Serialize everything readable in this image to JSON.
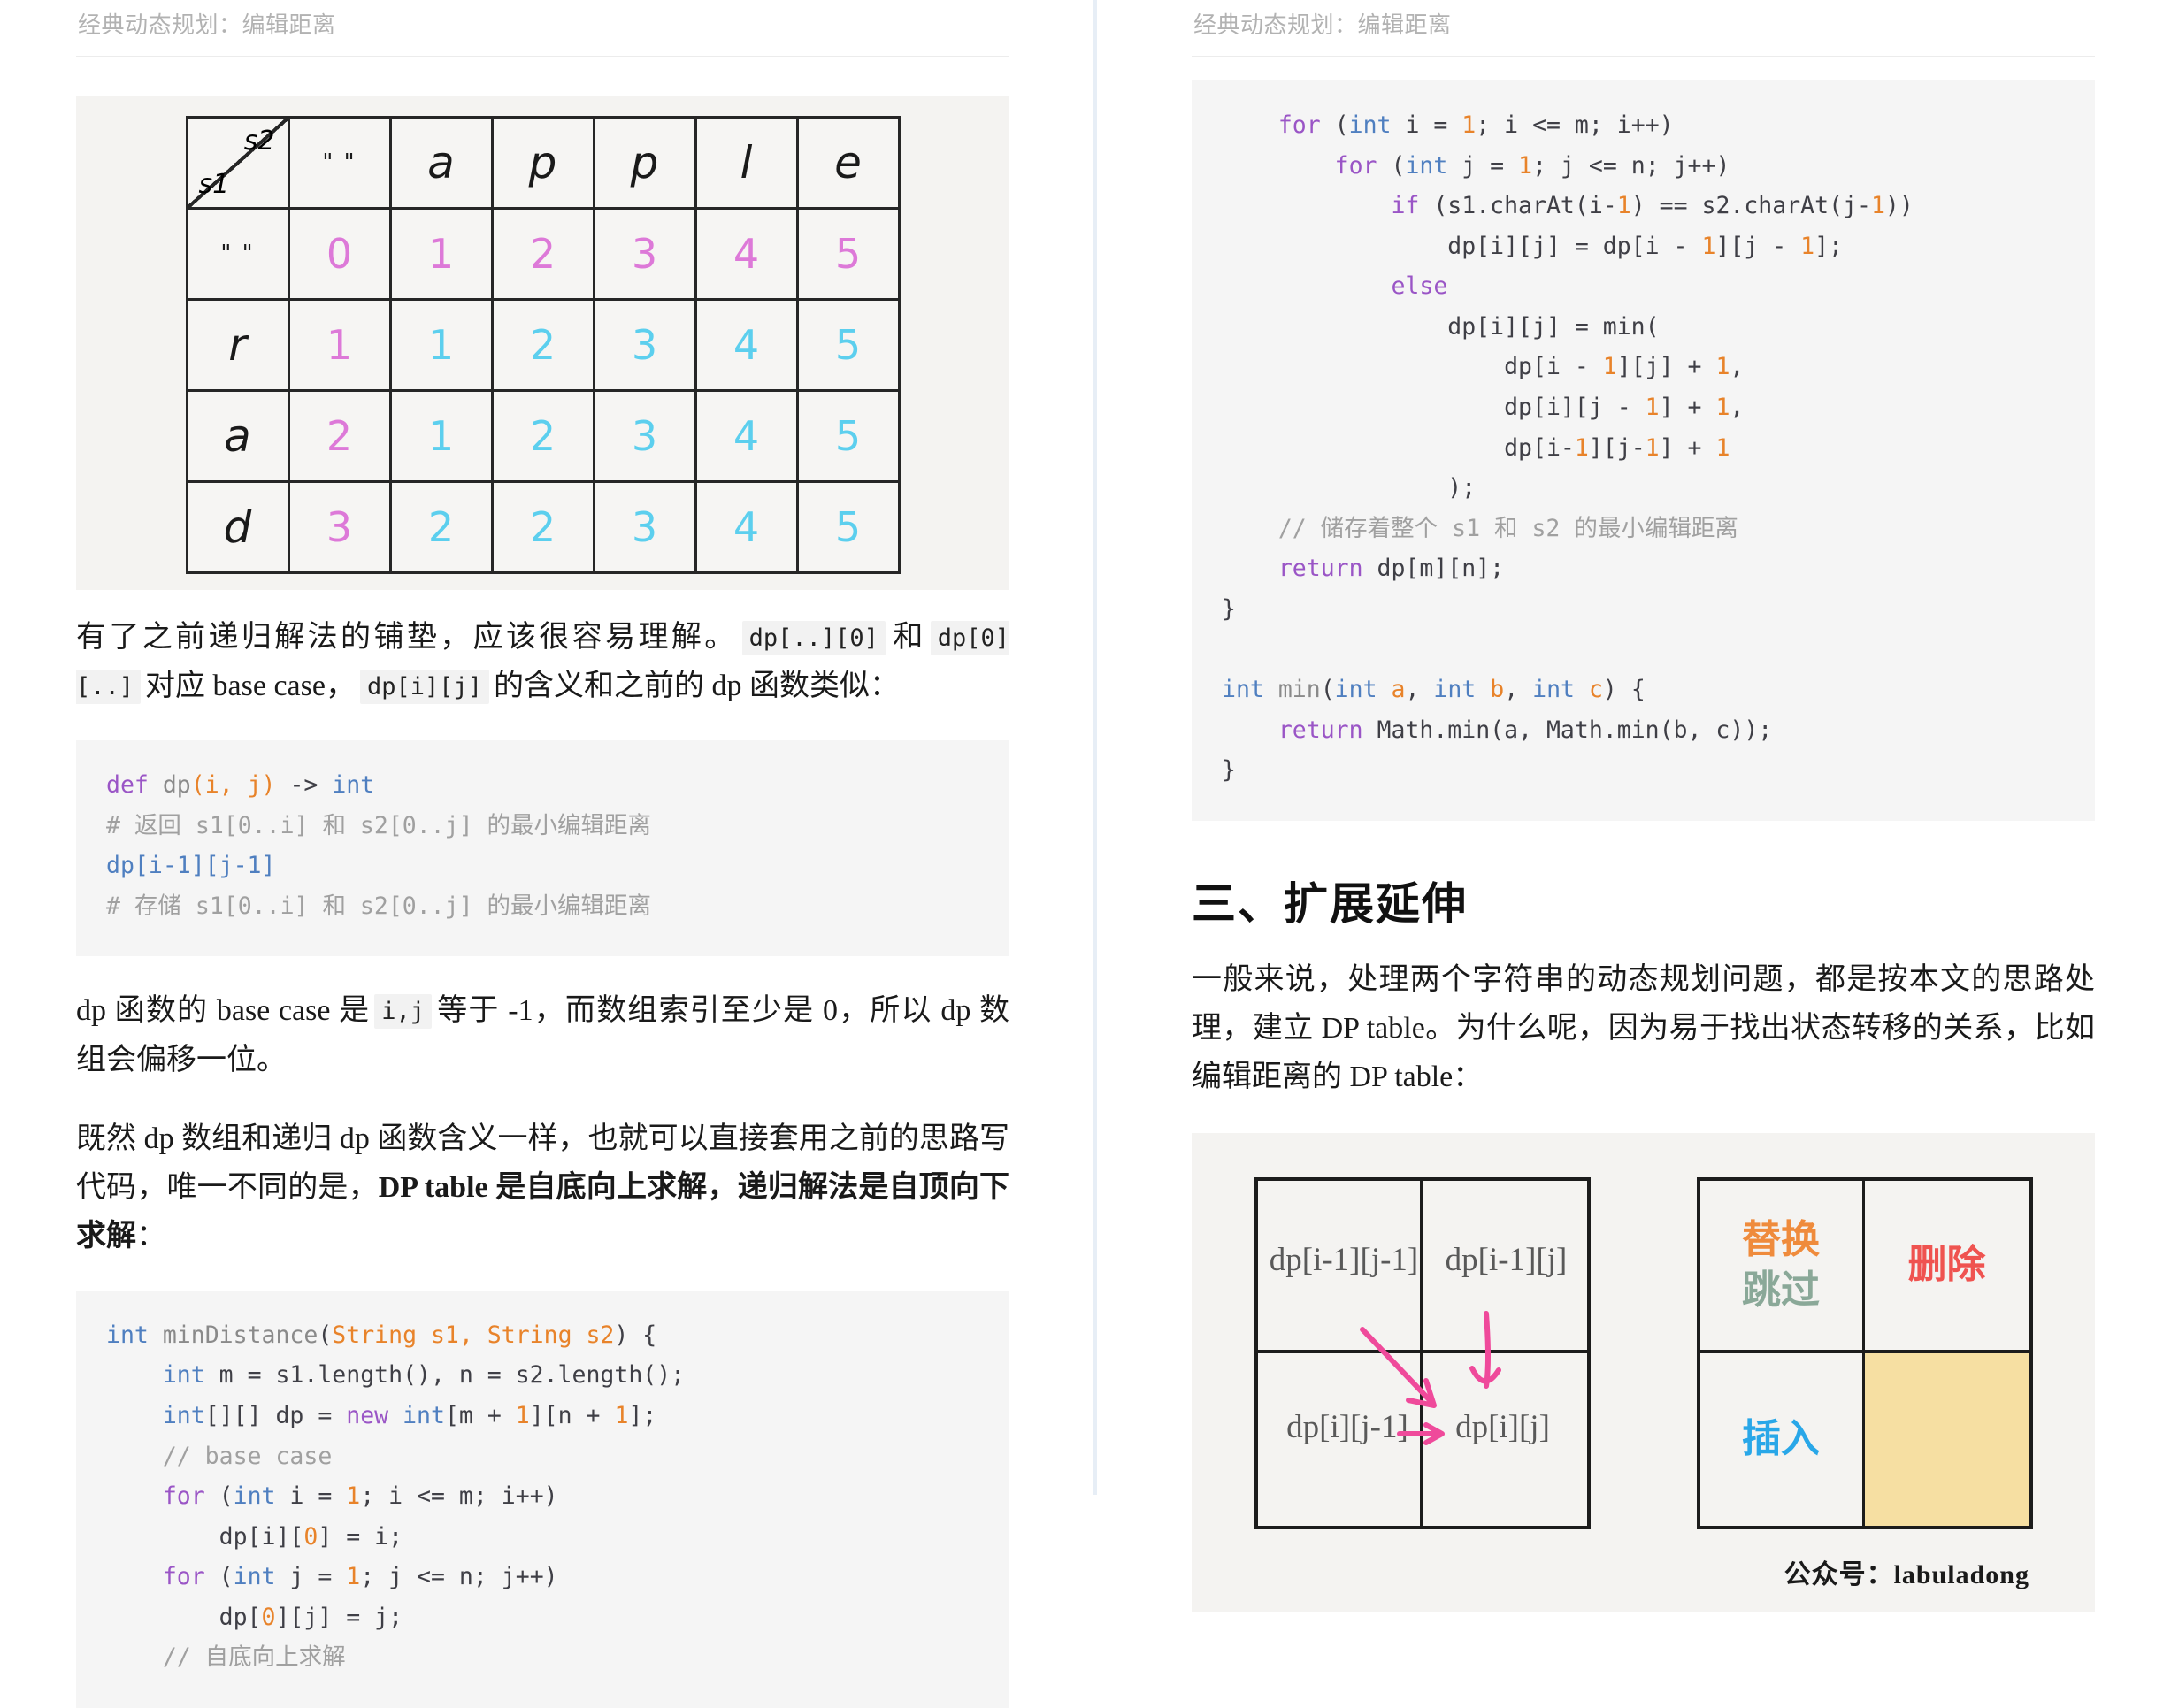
{
  "header": {
    "title": "经典动态规划：编辑距离"
  },
  "figure_dp_table": {
    "corner": {
      "s2": "s2",
      "s1": "s1"
    },
    "col_headers": [
      "\" \"",
      "a",
      "p",
      "p",
      "l",
      "e"
    ],
    "row_headers": [
      "\" \"",
      "r",
      "a",
      "d"
    ],
    "rows": [
      [
        "0",
        "1",
        "2",
        "3",
        "4",
        "5"
      ],
      [
        "1",
        "1",
        "2",
        "3",
        "4",
        "5"
      ],
      [
        "2",
        "1",
        "2",
        "3",
        "4",
        "5"
      ],
      [
        "3",
        "2",
        "2",
        "3",
        "4",
        "5"
      ]
    ],
    "colors": {
      "base": "#dd79d8",
      "computed": "#5ccfee"
    }
  },
  "left": {
    "para1": {
      "t1": "有了之前递归解法的铺垫，应该很容易理解。",
      "c1": "dp[..][0]",
      "t2": "和",
      "c2": "dp[0][..]",
      "t3": "对应 base case，",
      "c3": "dp[i][j]",
      "t4": "的含义和之前的 dp 函数类似："
    },
    "code1": [
      {
        "parts": [
          {
            "c": "k",
            "t": "def "
          },
          {
            "c": "fn",
            "t": "dp"
          },
          {
            "c": "pa",
            "t": "(i, j)"
          },
          {
            "c": "pl",
            "t": " -> "
          },
          {
            "c": "ty",
            "t": "int"
          }
        ]
      },
      {
        "parts": [
          {
            "c": "cm",
            "t": "# 返回 s1[0..i] 和 s2[0..j] 的最小编辑距离"
          }
        ]
      },
      {
        "parts": [
          {
            "c": "ty",
            "t": "dp[i-1][j-1]"
          }
        ]
      },
      {
        "parts": [
          {
            "c": "cm",
            "t": "# 存储 s1[0..i] 和 s2[0..j] 的最小编辑距离"
          }
        ]
      }
    ],
    "para2": {
      "t1": "dp 函数的 base case 是",
      "c1": "i,j",
      "t2": "等于 -1，而数组索引至少是 0，所以 dp 数组会偏移一位。"
    },
    "para3": {
      "t1": "既然 dp 数组和递归 dp 函数含义一样，也就可以直接套用之前的思路写代码，唯一不同的是，",
      "strong": "DP table 是自底向上求解，递归解法是自顶向下求解",
      "t2": "："
    },
    "code2": [
      {
        "parts": [
          {
            "c": "ty",
            "t": "int "
          },
          {
            "c": "fn",
            "t": "minDistance"
          },
          {
            "c": "pl",
            "t": "("
          },
          {
            "c": "pa",
            "t": "String s1, String s2"
          },
          {
            "c": "pl",
            "t": ") {"
          }
        ]
      },
      {
        "parts": [
          {
            "c": "pl",
            "t": "    "
          },
          {
            "c": "ty",
            "t": "int"
          },
          {
            "c": "pl",
            "t": " m = s1.length(), n = s2.length();"
          }
        ]
      },
      {
        "parts": [
          {
            "c": "pl",
            "t": "    "
          },
          {
            "c": "ty",
            "t": "int"
          },
          {
            "c": "pl",
            "t": "[][] dp = "
          },
          {
            "c": "k",
            "t": "new "
          },
          {
            "c": "ty",
            "t": "int"
          },
          {
            "c": "pl",
            "t": "[m + "
          },
          {
            "c": "pa",
            "t": "1"
          },
          {
            "c": "pl",
            "t": "][n + "
          },
          {
            "c": "pa",
            "t": "1"
          },
          {
            "c": "pl",
            "t": "];"
          }
        ]
      },
      {
        "parts": [
          {
            "c": "cm",
            "t": "    // base case"
          }
        ]
      },
      {
        "parts": [
          {
            "c": "pl",
            "t": "    "
          },
          {
            "c": "k",
            "t": "for"
          },
          {
            "c": "pl",
            "t": " ("
          },
          {
            "c": "ty",
            "t": "int"
          },
          {
            "c": "pl",
            "t": " i = "
          },
          {
            "c": "pa",
            "t": "1"
          },
          {
            "c": "pl",
            "t": "; i <= m; i++)"
          }
        ]
      },
      {
        "parts": [
          {
            "c": "pl",
            "t": "        dp[i]["
          },
          {
            "c": "pa",
            "t": "0"
          },
          {
            "c": "pl",
            "t": "] = i;"
          }
        ]
      },
      {
        "parts": [
          {
            "c": "pl",
            "t": "    "
          },
          {
            "c": "k",
            "t": "for"
          },
          {
            "c": "pl",
            "t": " ("
          },
          {
            "c": "ty",
            "t": "int"
          },
          {
            "c": "pl",
            "t": " j = "
          },
          {
            "c": "pa",
            "t": "1"
          },
          {
            "c": "pl",
            "t": "; j <= n; j++)"
          }
        ]
      },
      {
        "parts": [
          {
            "c": "pl",
            "t": "        dp["
          },
          {
            "c": "pa",
            "t": "0"
          },
          {
            "c": "pl",
            "t": "][j] = j;"
          }
        ]
      },
      {
        "parts": [
          {
            "c": "cm",
            "t": "    // 自底向上求解"
          }
        ]
      }
    ]
  },
  "right": {
    "code3": [
      {
        "parts": [
          {
            "c": "pl",
            "t": "    "
          },
          {
            "c": "k",
            "t": "for"
          },
          {
            "c": "pl",
            "t": " ("
          },
          {
            "c": "ty",
            "t": "int"
          },
          {
            "c": "pl",
            "t": " i = "
          },
          {
            "c": "pa",
            "t": "1"
          },
          {
            "c": "pl",
            "t": "; i <= m; i++)"
          }
        ]
      },
      {
        "parts": [
          {
            "c": "pl",
            "t": "        "
          },
          {
            "c": "k",
            "t": "for"
          },
          {
            "c": "pl",
            "t": " ("
          },
          {
            "c": "ty",
            "t": "int"
          },
          {
            "c": "pl",
            "t": " j = "
          },
          {
            "c": "pa",
            "t": "1"
          },
          {
            "c": "pl",
            "t": "; j <= n; j++)"
          }
        ]
      },
      {
        "parts": [
          {
            "c": "pl",
            "t": "            "
          },
          {
            "c": "k",
            "t": "if"
          },
          {
            "c": "pl",
            "t": " (s1.charAt(i-"
          },
          {
            "c": "pa",
            "t": "1"
          },
          {
            "c": "pl",
            "t": ") == s2.charAt(j-"
          },
          {
            "c": "pa",
            "t": "1"
          },
          {
            "c": "pl",
            "t": "))"
          }
        ]
      },
      {
        "parts": [
          {
            "c": "pl",
            "t": "                dp[i][j] = dp[i - "
          },
          {
            "c": "pa",
            "t": "1"
          },
          {
            "c": "pl",
            "t": "][j - "
          },
          {
            "c": "pa",
            "t": "1"
          },
          {
            "c": "pl",
            "t": "];"
          }
        ]
      },
      {
        "parts": [
          {
            "c": "pl",
            "t": "            "
          },
          {
            "c": "k",
            "t": "else"
          }
        ]
      },
      {
        "parts": [
          {
            "c": "pl",
            "t": "                dp[i][j] = min("
          }
        ]
      },
      {
        "parts": [
          {
            "c": "pl",
            "t": "                    dp[i - "
          },
          {
            "c": "pa",
            "t": "1"
          },
          {
            "c": "pl",
            "t": "][j] + "
          },
          {
            "c": "pa",
            "t": "1"
          },
          {
            "c": "pl",
            "t": ","
          }
        ]
      },
      {
        "parts": [
          {
            "c": "pl",
            "t": "                    dp[i][j - "
          },
          {
            "c": "pa",
            "t": "1"
          },
          {
            "c": "pl",
            "t": "] + "
          },
          {
            "c": "pa",
            "t": "1"
          },
          {
            "c": "pl",
            "t": ","
          }
        ]
      },
      {
        "parts": [
          {
            "c": "pl",
            "t": "                    dp[i-"
          },
          {
            "c": "pa",
            "t": "1"
          },
          {
            "c": "pl",
            "t": "][j-"
          },
          {
            "c": "pa",
            "t": "1"
          },
          {
            "c": "pl",
            "t": "] + "
          },
          {
            "c": "pa",
            "t": "1"
          }
        ]
      },
      {
        "parts": [
          {
            "c": "pl",
            "t": "                );"
          }
        ]
      },
      {
        "parts": [
          {
            "c": "cm",
            "t": "    // 储存着整个 s1 和 s2 的最小编辑距离"
          }
        ]
      },
      {
        "parts": [
          {
            "c": "pl",
            "t": "    "
          },
          {
            "c": "k",
            "t": "return"
          },
          {
            "c": "pl",
            "t": " dp[m][n];"
          }
        ]
      },
      {
        "parts": [
          {
            "c": "pl",
            "t": "}"
          }
        ]
      },
      {
        "parts": [
          {
            "c": "pl",
            "t": ""
          }
        ]
      },
      {
        "parts": [
          {
            "c": "ty",
            "t": "int "
          },
          {
            "c": "fn",
            "t": "min"
          },
          {
            "c": "pl",
            "t": "("
          },
          {
            "c": "ty",
            "t": "int"
          },
          {
            "c": "pa",
            "t": " a"
          },
          {
            "c": "pl",
            "t": ", "
          },
          {
            "c": "ty",
            "t": "int"
          },
          {
            "c": "pa",
            "t": " b"
          },
          {
            "c": "pl",
            "t": ", "
          },
          {
            "c": "ty",
            "t": "int"
          },
          {
            "c": "pa",
            "t": " c"
          },
          {
            "c": "pl",
            "t": ") {"
          }
        ]
      },
      {
        "parts": [
          {
            "c": "pl",
            "t": "    "
          },
          {
            "c": "k",
            "t": "return"
          },
          {
            "c": "pl",
            "t": " Math.min(a, Math.min(b, c));"
          }
        ]
      },
      {
        "parts": [
          {
            "c": "pl",
            "t": "}"
          }
        ]
      }
    ],
    "section_title": "三、扩展延伸",
    "para1": "一般来说，处理两个字符串的动态规划问题，都是按本文的思路处理，建立 DP table。为什么呢，因为易于找出状态转移的关系，比如编辑距离的 DP table："
  },
  "diagram": {
    "grid_labels": {
      "top_left": "dp[i-1][j-1]",
      "top_right": "dp[i-1][j]",
      "bottom_left": "dp[i][j-1]",
      "bottom_right": "dp[i][j]"
    },
    "ops": {
      "replace": "替换",
      "skip": "跳过",
      "delete": "删除",
      "insert": "插入"
    },
    "colors": {
      "arrow": "#ef4a9b",
      "replace": "#ef8b3c",
      "skip": "#8aa898",
      "delete": "#ef5350",
      "insert": "#29a7e8",
      "filled_cell": "#f6dfa2"
    },
    "watermark": "公众号：labuladong"
  }
}
